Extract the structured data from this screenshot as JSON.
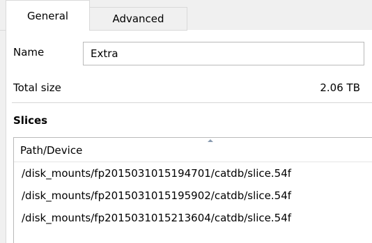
{
  "tabs": [
    {
      "label": "General",
      "active": true
    },
    {
      "label": "Advanced",
      "active": false
    }
  ],
  "general": {
    "name_label": "Name",
    "name_value": "Extra",
    "total_size_label": "Total size",
    "total_size_value": "2.06 TB",
    "slices_heading": "Slices",
    "slices_table": {
      "column_header": "Path/Device",
      "sort_icon": "sort-ascending-icon",
      "rows": [
        "/disk_mounts/fp20150310151947​01/catdb/slice.54f​",
        "/disk_mounts/fp20150310151959​02/catdb/slice.54f",
        "/disk_mounts/fp20150310152136​04/catdb/slice.54f"
      ]
    }
  },
  "colors": {
    "window_bg": "#f0f0f0",
    "panel_bg": "#ffffff",
    "border": "#b9b9b9",
    "sort_indicator": "#8a9bb0"
  }
}
